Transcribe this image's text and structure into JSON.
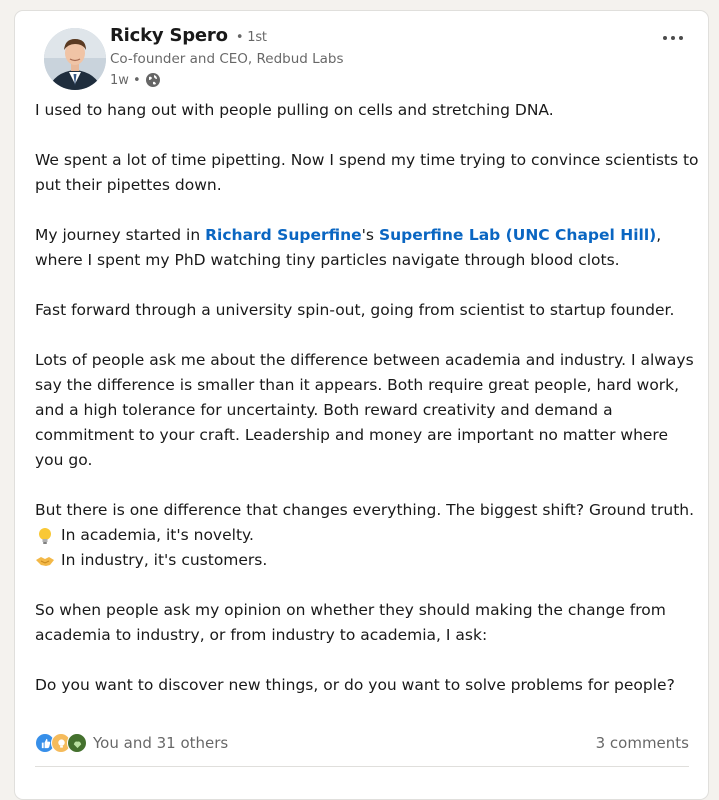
{
  "post": {
    "author": {
      "name": "Ricky Spero",
      "degree": "• 1st",
      "headline": "Co-founder and CEO, Redbud Labs",
      "time": "1w •"
    },
    "icons": {
      "more": "more-horizontal-icon",
      "visibility": "globe-icon",
      "emoji_1": "lightbulb-icon",
      "emoji_2": "handshake-icon"
    },
    "body": {
      "p1": "I used to hang out with people pulling on cells and stretching DNA.",
      "p2": "We spent a lot of time pipetting. Now I spend my time trying to convince scientists to put their pipettes down.",
      "p3": {
        "before": "My journey started in ",
        "mention_person": "Richard Superfine",
        "possessive": "'s ",
        "mention_org": "Superfine Lab (UNC Chapel Hill)",
        "after": ", where I spent my PhD watching tiny particles navigate through blood clots."
      },
      "p4": "Fast forward through a university spin-out, going from scientist to startup founder.",
      "p5": "Lots of people ask me about the difference between academia and industry. I always say the difference is smaller than it appears. Both require great people, hard work, and a high tolerance for uncertainty. Both reward creativity and demand a commitment to your craft. Leadership and money are important no matter where you go.",
      "p6": "But there is one difference that changes everything. The biggest shift? Ground truth.",
      "bullet_1": "In academia, it's novelty.",
      "bullet_2": "In industry, it's customers.",
      "p7": "So when people ask my opinion on whether they should making the change from academia to industry, or from industry to academia, I ask:",
      "p8": "Do you want to discover new things, or do you want to solve problems for people?"
    },
    "social": {
      "reactions_label": "You and 31 others",
      "reaction_icons": [
        "like-icon",
        "insightful-icon",
        "support-icon"
      ],
      "comments_label": "3 comments"
    }
  },
  "colors": {
    "link": "#0a66c2",
    "background": "#f4f2ee",
    "card": "#ffffff"
  }
}
